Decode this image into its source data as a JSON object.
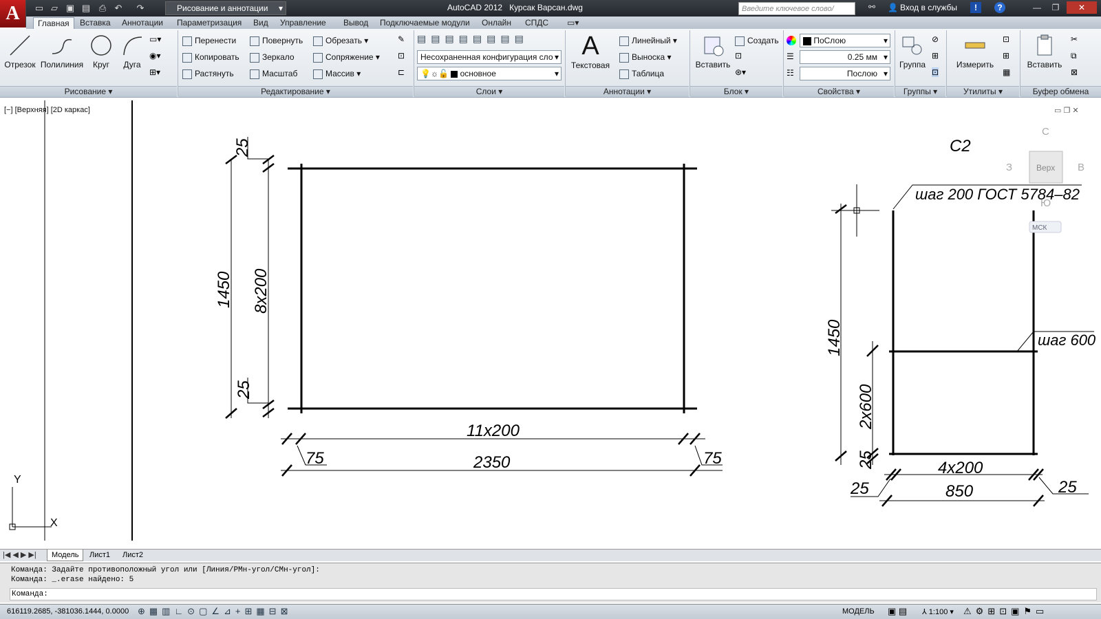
{
  "titlebar": {
    "app_title": "AutoCAD 2012",
    "file": "Курсак Варсан.dwg",
    "workspace": "Рисование и аннотации",
    "search_placeholder": "Введите ключевое слово/фразу",
    "login": "Вход в службы"
  },
  "tabs": [
    "Главная",
    "Вставка",
    "Аннотации",
    "Параметризация",
    "Вид",
    "Управление",
    "Вывод",
    "Подключаемые модули",
    "Онлайн",
    "СПДС"
  ],
  "ribbon": {
    "draw": {
      "line": "Отрезок",
      "polyline": "Полилиния",
      "circle": "Круг",
      "arc": "Дуга",
      "title": "Рисование"
    },
    "modify": {
      "move": "Перенести",
      "rotate": "Повернуть",
      "trim": "Обрезать",
      "copy": "Копировать",
      "mirror": "Зеркало",
      "fillet": "Сопряжение",
      "stretch": "Растянуть",
      "scale": "Масштаб",
      "array": "Массив",
      "title": "Редактирование"
    },
    "layers": {
      "config": "Несохраненная конфигурация сло",
      "current": "основное",
      "title": "Слои"
    },
    "annotation": {
      "text": "Текстовая",
      "linear": "Линейный",
      "leader": "Выноска",
      "table": "Таблица",
      "title": "Аннотации"
    },
    "block": {
      "insert": "Вставить",
      "create": "Создать",
      "title": "Блок"
    },
    "properties": {
      "color": "ПоСлою",
      "lineweight": "0.25 мм",
      "linetype": "Послою",
      "title": "Свойства"
    },
    "groups": {
      "group": "Группа",
      "title": "Группы"
    },
    "utilities": {
      "measure": "Измерить",
      "title": "Утилиты"
    },
    "clipboard": {
      "paste": "Вставить",
      "title": "Буфер обмена"
    }
  },
  "viewport": {
    "label": "[−] [Верхняя] [2D каркас]"
  },
  "viewcube": {
    "top": "Верх",
    "north": "С",
    "south": "Ю",
    "west": "З",
    "east": "В",
    "ucs": "МСК"
  },
  "drawing": {
    "left": {
      "d1": "25",
      "d2": "1450",
      "d3": "8х200",
      "d4": "25",
      "d5": "11х200",
      "d6": "75",
      "d7": "2350",
      "d8": "75"
    },
    "right": {
      "title": "С2",
      "note1": "шаг 200  ГОСТ 5784–82",
      "note2": "шаг 600",
      "d1": "1450",
      "d2": "2х600",
      "d3": "25",
      "d4": "4х200",
      "d5": "25",
      "d6": "850",
      "d7": "25"
    },
    "axes": {
      "y": "Y",
      "x": "X"
    }
  },
  "layout_tabs": [
    "Модель",
    "Лист1",
    "Лист2"
  ],
  "command": {
    "line1": "Команда: Задайте противоположный угол или [Линия/РМн-угол/СМн-угол]:",
    "line2": "Команда: _.erase найдено: 5",
    "prompt": "Команда:"
  },
  "status": {
    "coords": "616119.2685, -381036.1444, 0.0000",
    "model": "МОДЕЛЬ",
    "scale": "1:100"
  }
}
